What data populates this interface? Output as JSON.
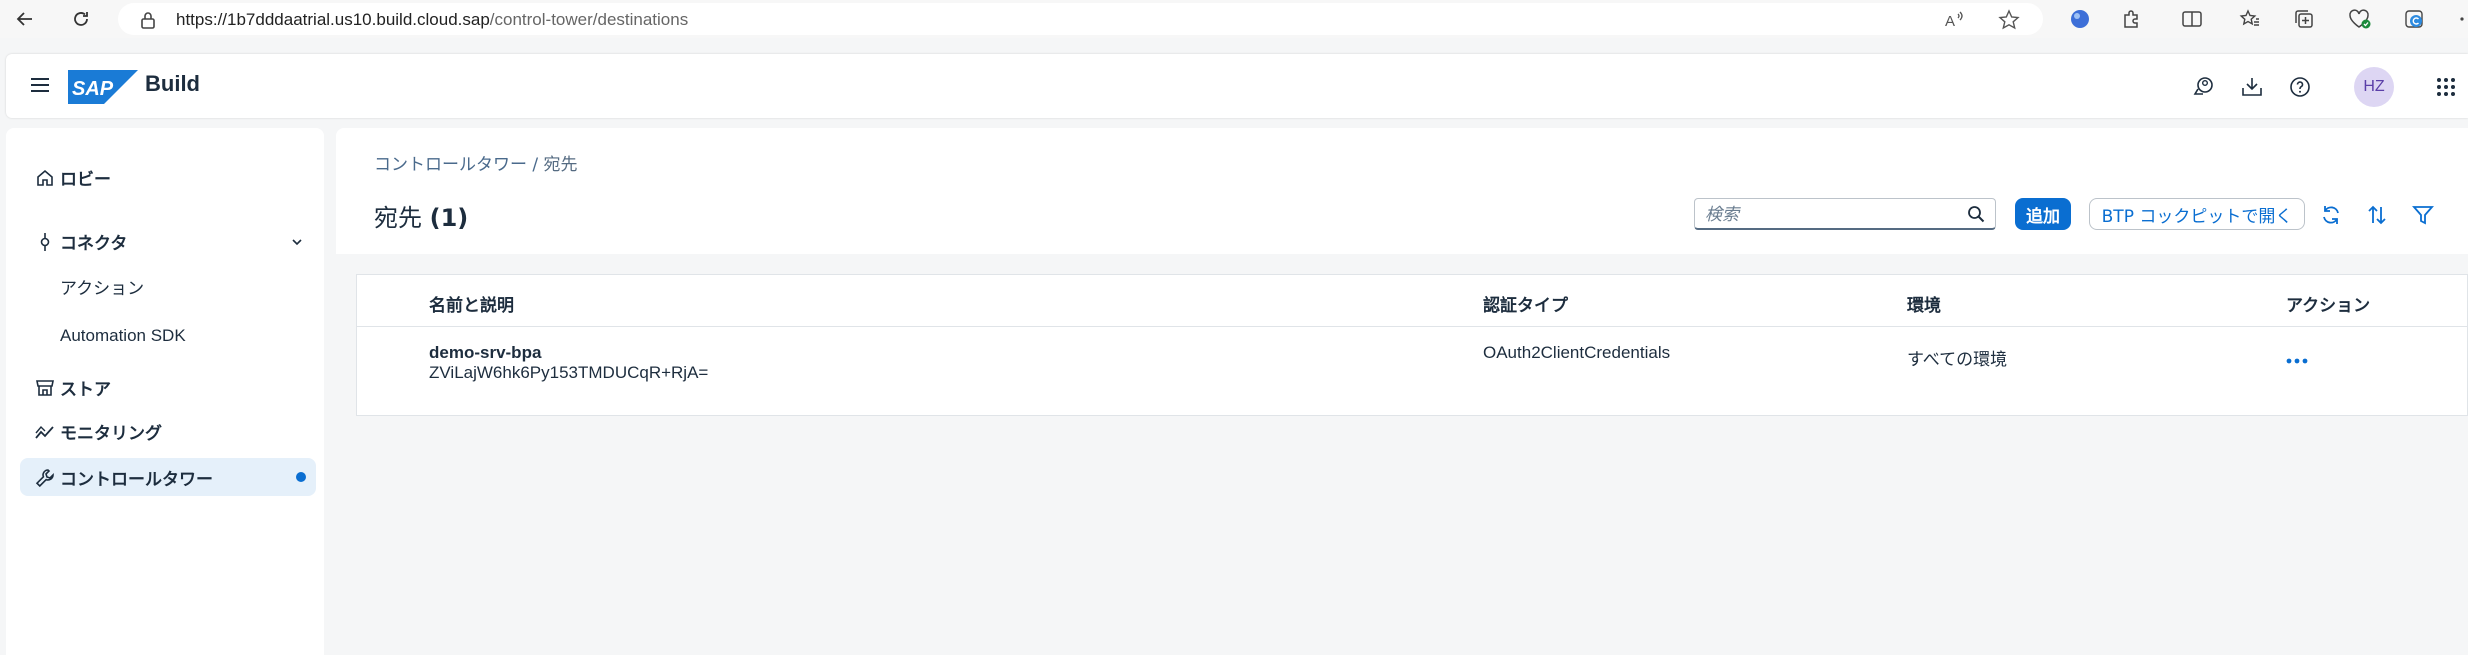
{
  "browser": {
    "url_host": "https://1b7dddaatrial.us10.build.cloud.sap",
    "url_path": "/control-tower/destinations"
  },
  "header": {
    "logo_text": "SAP",
    "app_title": "Build",
    "avatar_initials": "HZ"
  },
  "sidebar": {
    "items": [
      {
        "label": "ロビー"
      },
      {
        "label": "コネクタ"
      },
      {
        "label": "アクション"
      },
      {
        "label": "Automation SDK"
      },
      {
        "label": "ストア"
      },
      {
        "label": "モニタリング"
      },
      {
        "label": "コントロールタワー"
      }
    ]
  },
  "main": {
    "breadcrumb_link": "コントロールタワー",
    "breadcrumb_sep": " / ",
    "breadcrumb_current": "宛先",
    "title": "宛先",
    "count": "(1)",
    "search_placeholder": "検索",
    "add_label": "追加",
    "open_cockpit_label": "BTP コックピットで開く"
  },
  "table": {
    "headers": [
      "名前と説明",
      "認証タイプ",
      "環境",
      "アクション"
    ],
    "rows": [
      {
        "name": "demo-srv-bpa",
        "description": "ZViLajW6hk6Py153TMDUCqR+RjA=",
        "auth_type": "OAuth2ClientCredentials",
        "environment": "すべての環境"
      }
    ]
  },
  "colors": {
    "accent": "#0a6ed1",
    "active_bg": "#e5f0fa",
    "text": "#1d2d3e"
  }
}
